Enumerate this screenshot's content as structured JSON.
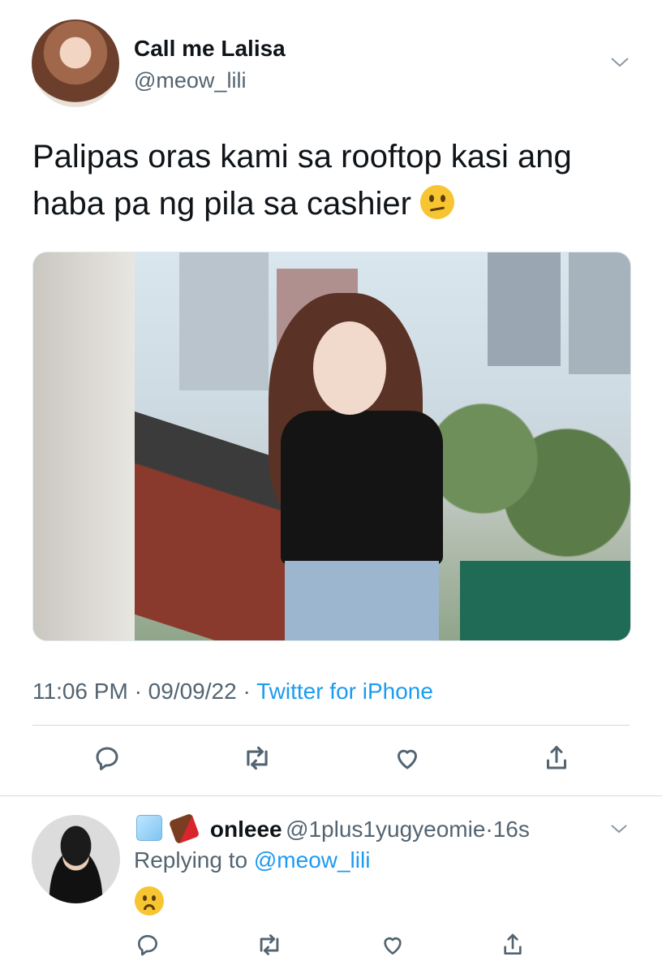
{
  "tweet": {
    "display_name": "Call me Lalisa",
    "handle": "@meow_lili",
    "text": "Palipas oras kami sa rooftop kasi ang haba pa ng pila sa cashier",
    "text_emoji": "confused-face",
    "time": "11:06 PM",
    "date": "09/09/22",
    "source": "Twitter for iPhone",
    "separator": "·"
  },
  "reply": {
    "prefix_emojis": [
      "ice-cube",
      "chocolate-bar"
    ],
    "display_name": "onleee",
    "handle": "@1plus1yugyeomie",
    "separator": "·",
    "age": "16s",
    "replying_to_label": "Replying to",
    "replying_to_handle": "@meow_lili",
    "body_emoji": "worried-face"
  },
  "actions": [
    "reply-icon",
    "retweet-icon",
    "like-icon",
    "share-icon"
  ],
  "colors": {
    "link": "#1d9bf0",
    "secondary_text": "#536471",
    "divider": "#cfd9de"
  }
}
